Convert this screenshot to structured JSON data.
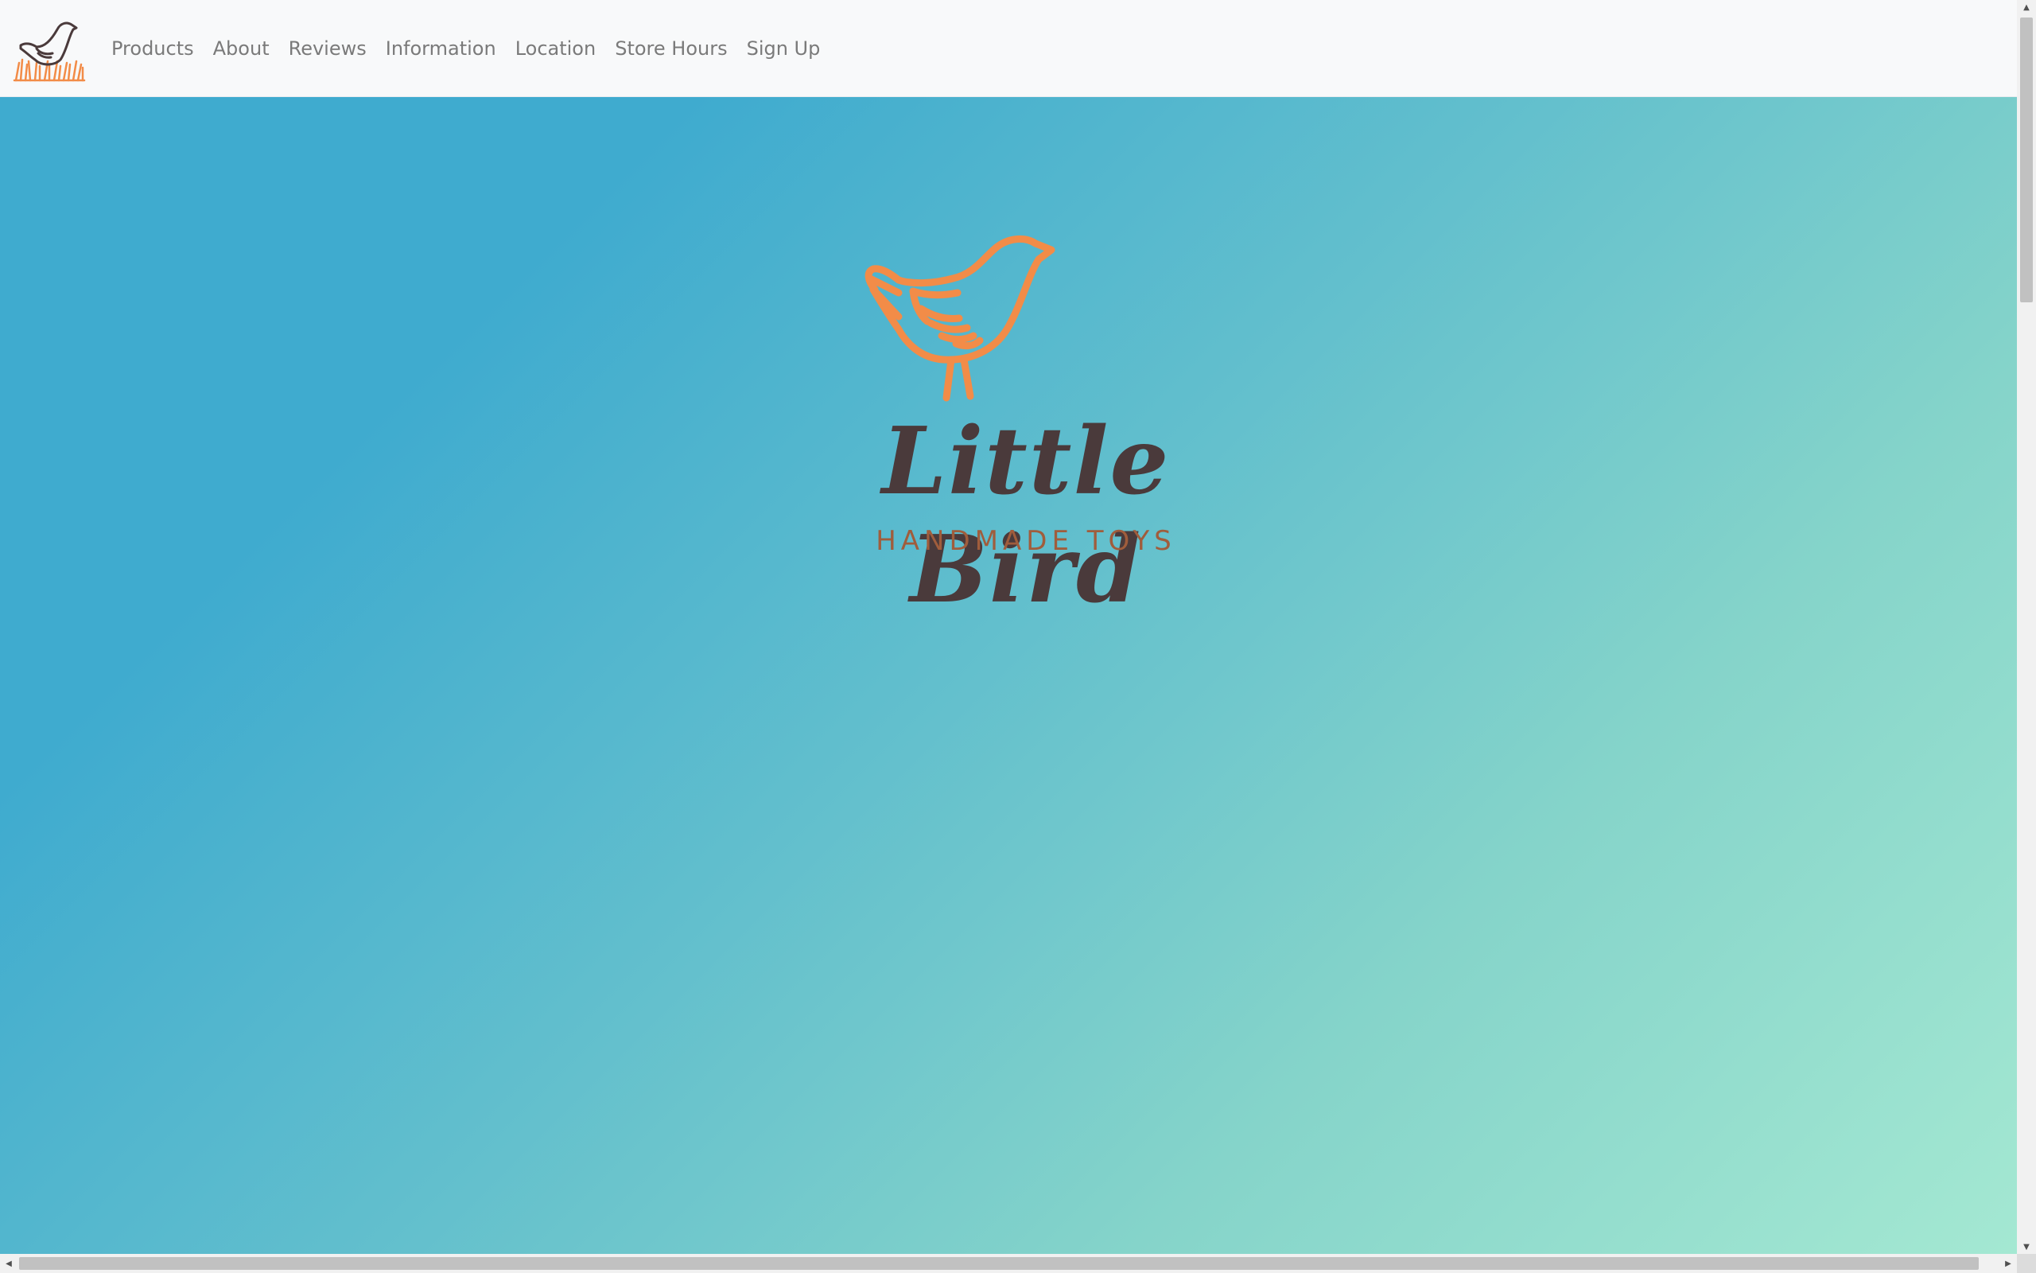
{
  "navbar": {
    "brand_icon": "bird-in-grass-logo-icon",
    "links": [
      {
        "label": "Products"
      },
      {
        "label": "About"
      },
      {
        "label": "Reviews"
      },
      {
        "label": "Information"
      },
      {
        "label": "Location"
      },
      {
        "label": "Store Hours"
      },
      {
        "label": "Sign Up"
      }
    ]
  },
  "hero": {
    "logo_icon": "orange-bird-outline-icon",
    "title": "Little Bird",
    "subtitle": "HANDMADE TOYS"
  },
  "colors": {
    "navbar_bg": "#f8f9fa",
    "nav_text": "#7a7a7a",
    "gradient_start": "#3fabcf",
    "gradient_end": "#a4e8d2",
    "bird_orange": "#f28c48",
    "title_brown": "#4a3a3b",
    "subtitle_brown": "#a05d3c"
  },
  "scrollbars": {
    "up_arrow_icon": "arrow-up-icon",
    "down_arrow_icon": "arrow-down-icon",
    "left_arrow_icon": "arrow-left-icon",
    "right_arrow_icon": "arrow-right-icon"
  }
}
